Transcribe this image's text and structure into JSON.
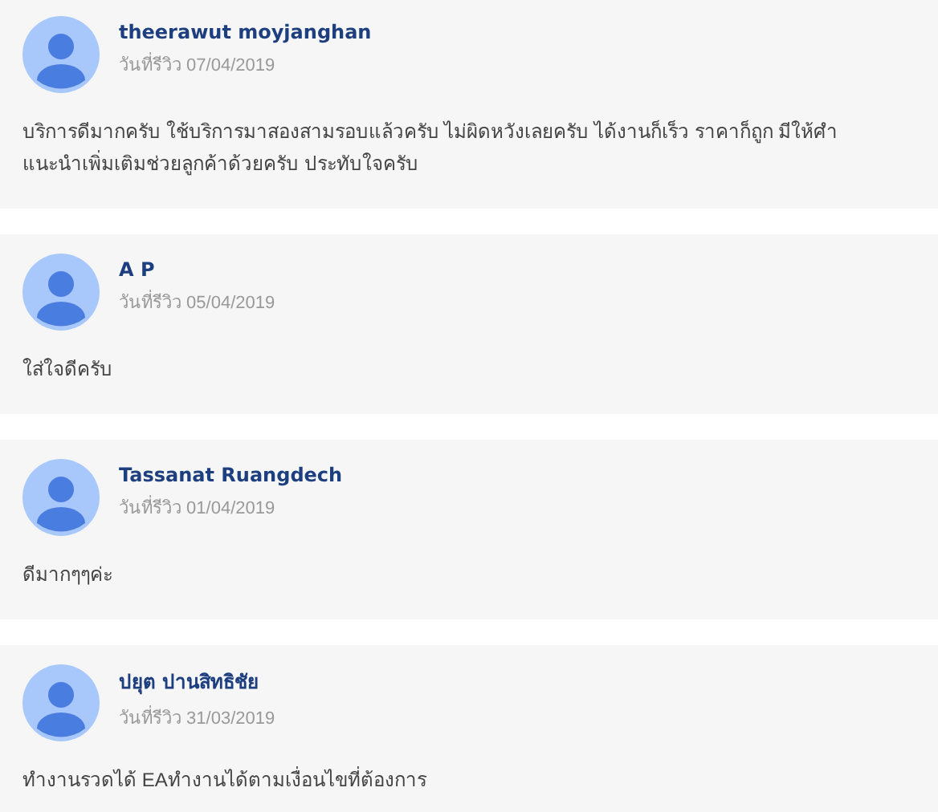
{
  "reviews": [
    {
      "name": "theerawut moyjanghan",
      "date": "วันที่รีวิว 07/04/2019",
      "text": "บริการดีมากครับ ใช้บริการมาสองสามรอบแล้วครับ ไม่ผิดหวังเลยครับ ได้งานก็เร็ว ราคาก็ถูก มีให้ศำแนะนำเพิ่มเติมช่วยลูกค้าด้วยครับ ประทับใจครับ"
    },
    {
      "name": "A P",
      "date": "วันที่รีวิว 05/04/2019",
      "text": "ใส่ใจดีครับ"
    },
    {
      "name": "Tassanat Ruangdech",
      "date": "วันที่รีวิว 01/04/2019",
      "text": "ดีมากๆๆค่ะ"
    },
    {
      "name": "ปยุต ปานสิทธิชัย",
      "date": "วันที่รีวิว 31/03/2019",
      "text": "ทำงานรวดได้ EAทำงานได้ตามเงื่อนไขที่ต้องการ"
    }
  ]
}
